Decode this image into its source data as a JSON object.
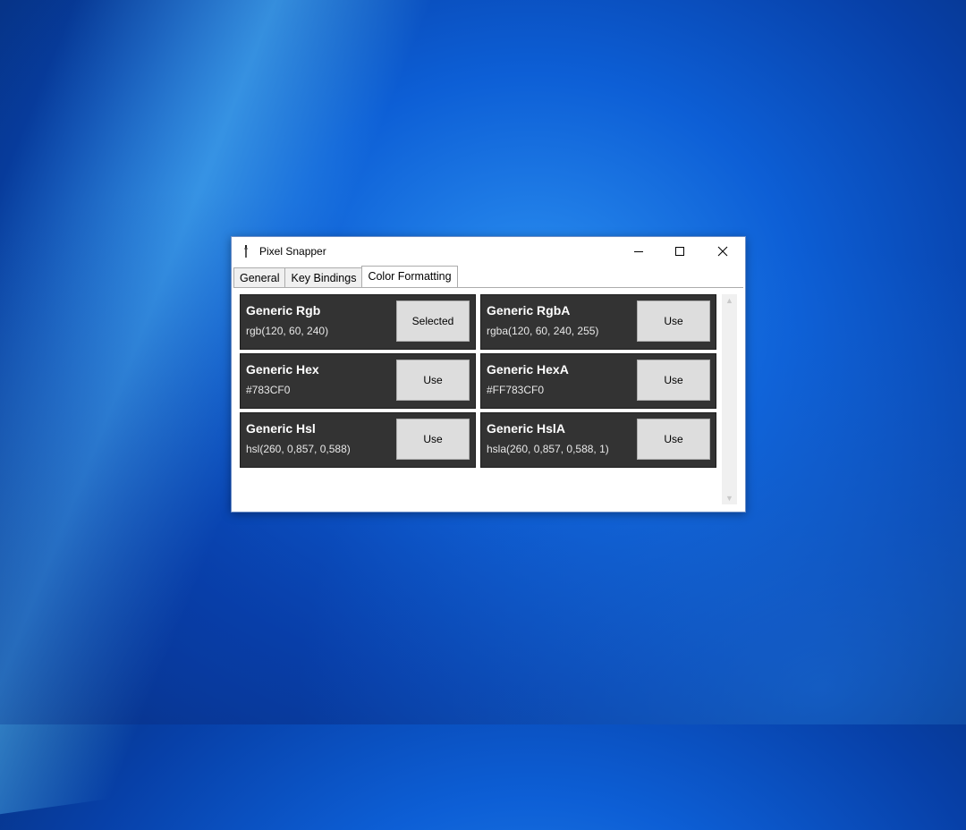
{
  "window": {
    "title": "Pixel Snapper",
    "controls": {
      "minimize": "minimize-icon",
      "maximize": "maximize-icon",
      "close": "close-icon"
    }
  },
  "tabs": [
    {
      "label": "General",
      "active": false
    },
    {
      "label": "Key Bindings",
      "active": false
    },
    {
      "label": "Color Formatting",
      "active": true
    }
  ],
  "formats": [
    {
      "name": "Generic Rgb",
      "value": "rgb(120, 60, 240)",
      "button": "Selected"
    },
    {
      "name": "Generic RgbA",
      "value": "rgba(120, 60, 240, 255)",
      "button": "Use"
    },
    {
      "name": "Generic Hex",
      "value": "#783CF0",
      "button": "Use"
    },
    {
      "name": "Generic HexA",
      "value": "#FF783CF0",
      "button": "Use"
    },
    {
      "name": "Generic Hsl",
      "value": "hsl(260, 0,857, 0,588)",
      "button": "Use"
    },
    {
      "name": "Generic HslA",
      "value": "hsla(260, 0,857, 0,588, 1)",
      "button": "Use"
    }
  ],
  "colors": {
    "card_bg": "#333333",
    "button_bg": "#dddddd",
    "desktop": "#0d5fd6"
  }
}
